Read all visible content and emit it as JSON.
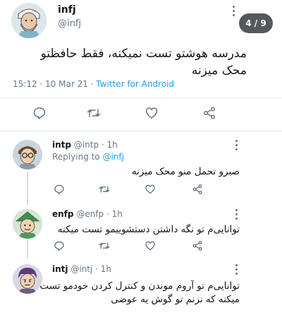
{
  "main_tweet": {
    "name": "infj",
    "handle": "@infj",
    "text_line1": "مدرسه هوشتو تست نمیکنه، فقط حافظتو",
    "text_line2": "محک میزنه",
    "time": "15:12 · 10 Mar 21 · ",
    "source": "Twitter for Android",
    "avatar_icon": "old-man-avatar-icon"
  },
  "page_counter": "4 / 9",
  "replies": [
    {
      "name": "intp",
      "meta": " @intp · 1h",
      "replying_label": "Replying to ",
      "replying_to": "@infj",
      "text": "صبرو تحمل منو محک میزنه",
      "avatar_icon": "glasses-avatar-icon"
    },
    {
      "name": "enfp",
      "meta": " @enfp · 1h",
      "text": "توانایی‌م تو نگه داشتن دستشوییمو تست میکنه",
      "avatar_icon": "green-hat-avatar-icon"
    },
    {
      "name": "intj",
      "meta": " @intj · 1h",
      "text_line1": "توانایی‌م تو آروم موندن و کنترل کردن خودمو تست",
      "text_line2": "میکنه که نزنم تو گوش یه عوضی",
      "avatar_icon": "purple-hair-avatar-icon"
    }
  ],
  "colors": {
    "link": "#1da1f2",
    "muted": "#657786",
    "counter_bg": "#56595b",
    "divider": "#e1e8ed"
  }
}
